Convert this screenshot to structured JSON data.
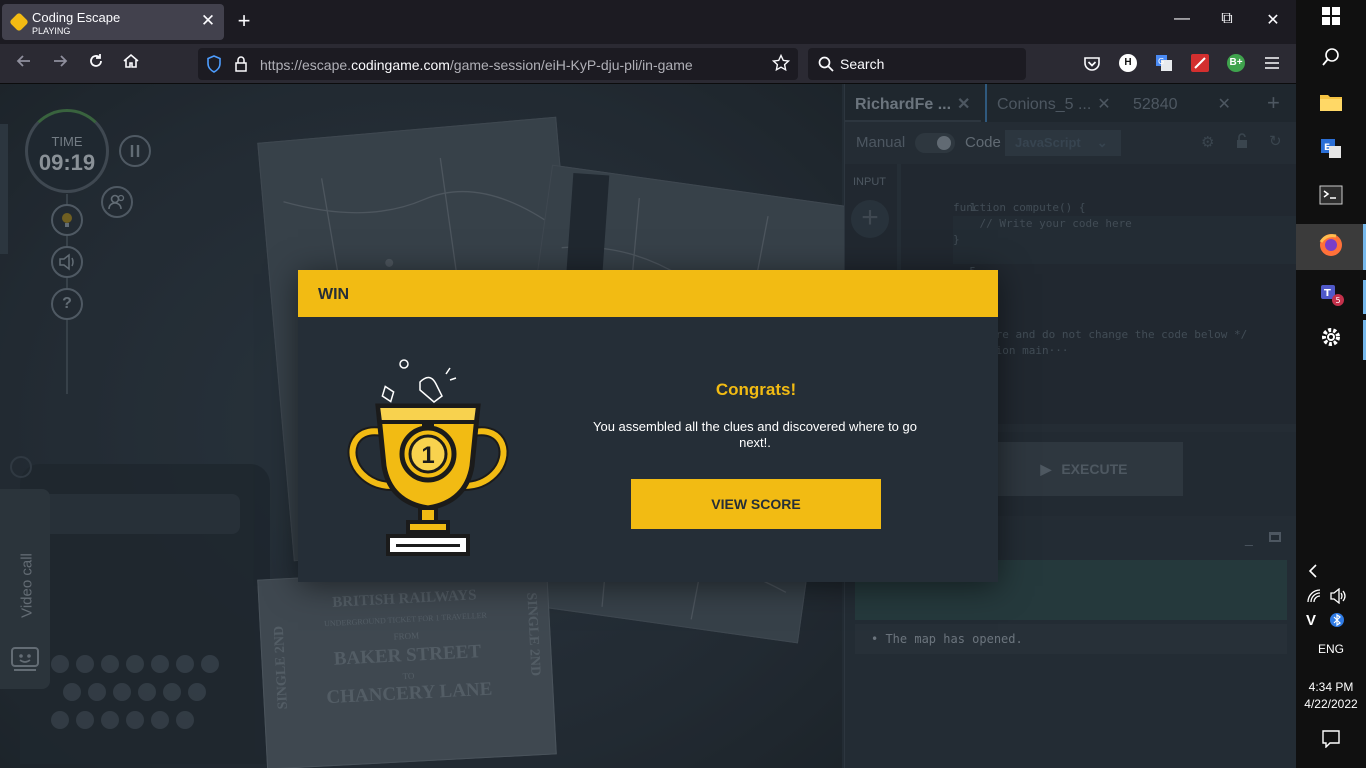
{
  "browser": {
    "tab": {
      "title": "Coding Escape",
      "subtitle": "PLAYING",
      "close": "✕"
    },
    "new_tab": "+",
    "window": {
      "minimize": "—",
      "restore": "⧉",
      "close": "✕"
    },
    "url_prefix": "https://escape.",
    "url_domain": "codingame.com",
    "url_path": "/game-session/eiH-KyP-dju-pli/in-game",
    "search_label": "Search",
    "extensions": [
      {
        "label": "H",
        "color": "#ffffff"
      },
      {
        "label": "B+",
        "color": "#3fa34d"
      }
    ]
  },
  "game": {
    "timer": {
      "label": "TIME",
      "value": "09:19"
    },
    "video_call": "Video call",
    "help": "?",
    "ticket": {
      "line1": "BRITISH RAILWAYS",
      "line2": "UNDERGROUND TICKET FOR 1 TRAVELLER",
      "line3": "FROM",
      "line4": "BAKER STREET",
      "line5": "TO",
      "line6": "CHANCERY LANE",
      "side": "SINGLE 2ND"
    }
  },
  "panel": {
    "tabs": [
      {
        "label": "RichardFe ..."
      },
      {
        "label": "Conions_5 ..."
      },
      {
        "label": "52840"
      }
    ],
    "add_tab": "+",
    "manual_label": "Manual",
    "code_label": "Code",
    "language": "JavaScript",
    "input_label": "INPUT",
    "line_numbers": [
      "1",
      "2",
      "3",
      "4",
      "5",
      "6",
      "7"
    ],
    "code_lines": [
      "",
      "",
      "function compute() {",
      "    // Write your code here",
      "",
      "",
      "}"
    ],
    "code_partial_1": "ore and do not change the code below */",
    "code_partial_2": "gion main···",
    "execute_label": "EXECUTE",
    "console_log": "• The map has opened."
  },
  "modal": {
    "header": "WIN",
    "title": "Congrats!",
    "message": "You assembled all the clues and discovered where to go next!.",
    "button": "VIEW SCORE",
    "trophy_number": "1",
    "accent": "#f2bb13"
  },
  "taskbar": {
    "language": "ENG",
    "time": "4:34 PM",
    "date": "4/22/2022",
    "teams_badge": "5"
  }
}
